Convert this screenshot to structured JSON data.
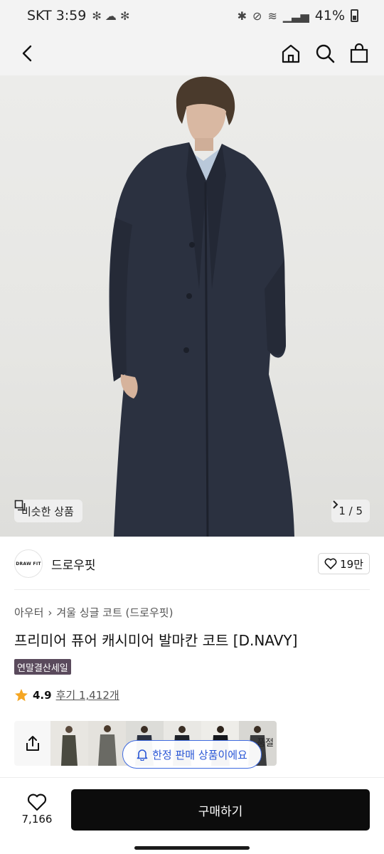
{
  "status_bar": {
    "carrier_time": "SKT 3:59",
    "battery": "41%"
  },
  "nav": {
    "back_icon": "chevron-left-icon",
    "home_icon": "home-icon",
    "search_icon": "search-icon",
    "cart_icon": "shopping-bag-icon"
  },
  "hero": {
    "similar_label": "비슷한 상품",
    "page_indicator": "1 / 5"
  },
  "brand": {
    "logo_text": "DRAW FIT",
    "name": "드로우핏",
    "like_count": "19만"
  },
  "product": {
    "breadcrumb": [
      "아우터",
      "겨울 싱글 코트 (드로우핏)"
    ],
    "title": "프리미어 퓨어 캐시미어 발마칸 코트 [D.NAVY]",
    "sale_badge": "연말결산세일",
    "rating": "4.9",
    "review_label": "후기 1,412개"
  },
  "thumbnail_strip": {
    "overflow_text": "품절"
  },
  "toast": {
    "text": "한정 판매 상품이에요"
  },
  "bottom_bar": {
    "wish_count": "7,166",
    "buy_label": "구매하기"
  },
  "colors": {
    "coat": "#2b3140",
    "badge": "#5a4a5c",
    "toast_blue": "#2a57d6",
    "star": "#f5a623"
  }
}
